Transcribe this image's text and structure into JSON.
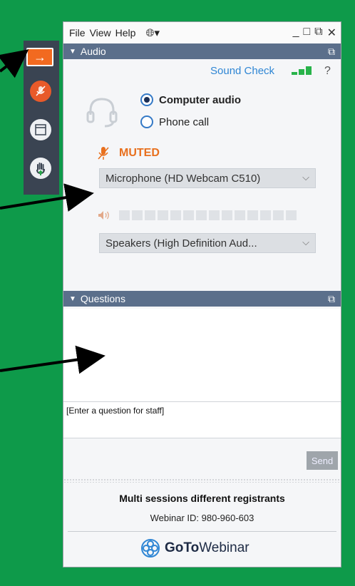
{
  "menu": {
    "file": "File",
    "view": "View",
    "help": "Help"
  },
  "window_controls": {
    "minimize": "_",
    "restore": "□",
    "popout": "⧉",
    "close": "✕"
  },
  "audio": {
    "header": "Audio",
    "sound_check": "Sound Check",
    "help": "?",
    "options": [
      "Computer audio",
      "Phone call"
    ],
    "selected_option": "Computer audio",
    "mute_status": "MUTED",
    "microphone": "Microphone (HD Webcam C510)",
    "speakers": "Speakers (High Definition Aud..."
  },
  "questions": {
    "header": "Questions",
    "input_placeholder": "[Enter a question for staff]",
    "send": "Send"
  },
  "footer": {
    "title": "Multi sessions different registrants",
    "webinar_id": "Webinar ID: 980-960-603",
    "brand_bold": "GoTo",
    "brand_rest": "Webinar"
  },
  "colors": {
    "background": "#0e9a4a",
    "section_header": "#5b6f8b",
    "muted": "#e8701e",
    "toolbar": "#3a4452",
    "accent_blue": "#2f86d4"
  },
  "icons": [
    "expand-arrow-icon",
    "mic-muted-icon",
    "screen-icon",
    "hand-raise-icon",
    "headset-icon",
    "globe-icon",
    "speaker-icon",
    "gotowebinar-logo-icon"
  ]
}
